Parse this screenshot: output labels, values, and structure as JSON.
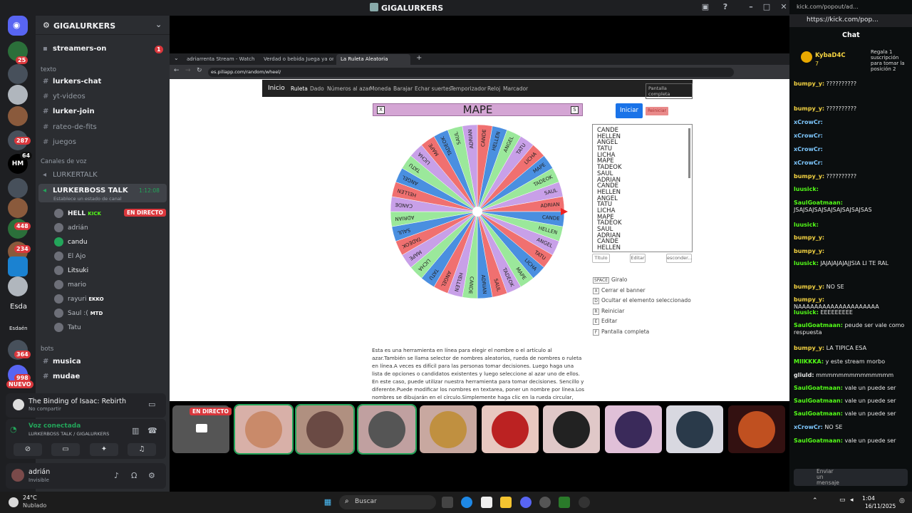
{
  "titlebar": {
    "title": "GIGALURKERS"
  },
  "server_rail": {
    "badges": [
      "25",
      "287",
      "448",
      "234",
      "364",
      "998",
      "NUEVO"
    ],
    "hm_label": "HM",
    "hm_badge": "64",
    "text_labels": [
      "Esda",
      "Esdaén"
    ]
  },
  "sidebar": {
    "server_name": "GIGALURKERS",
    "streamers_on": "streamers-on",
    "streamers_badge": "1",
    "cat_texto": "texto",
    "text_channels": [
      "lurkers-chat",
      "yt-videos",
      "lurker-join",
      "rateo-de-fits",
      "juegos"
    ],
    "cat_voz": "Canales de voz",
    "voice_lurkertalk": "LURKERTALK",
    "voice_boss": "LURKERBOSS TALK",
    "voice_timer": "1:12:08",
    "voice_status": "Establece un estado de canal",
    "users": [
      {
        "name": "HELL",
        "tag": "KICK",
        "live": "EN DIRECTO"
      },
      {
        "name": "adrián"
      },
      {
        "name": "candu"
      },
      {
        "name": "El Ajo"
      },
      {
        "name": "Litsuki"
      },
      {
        "name": "mario"
      },
      {
        "name": "rayuri",
        "tag": "EKKO"
      },
      {
        "name": "Saul :(",
        "tag": "MTD"
      },
      {
        "name": "Tatu"
      }
    ],
    "cat_bots": "bots",
    "bot_channels": [
      "musica",
      "mudae"
    ]
  },
  "activity": {
    "game": "The Binding of Isaac: Rebirth",
    "sub": "No compartir"
  },
  "voice_panel": {
    "title": "Voz conectada",
    "sub": "LURKERBOSS TALK / GIGALURKERS"
  },
  "user_panel": {
    "name": "adrián",
    "status": "Invisible"
  },
  "browser": {
    "tabs": [
      "adriarrenta Stream - Watch Liv...",
      "Verdad o bebida Juega ya onlin...",
      "La Ruleta Aleatoria"
    ],
    "url": "es.piliapp.com/random/wheel/"
  },
  "page": {
    "nav": [
      "Inicio",
      "Ruleta",
      "Dado",
      "Números al azar",
      "Moneda",
      "Barajar",
      "Echar suertes",
      "Temporizador",
      "Reloj",
      "Marcador",
      "Pantalla completa"
    ],
    "wheel_title": "MAPE",
    "close_x": "X",
    "s_label": "S",
    "start_btn": "Iniciar",
    "reset_btn": "Reiniciar",
    "names": [
      "CANDE",
      "HELLEN",
      "ANGEL",
      "TATU",
      "LICHA",
      "MAPE",
      "TADEOK",
      "SAUL",
      "ADRIAN",
      "CANDE",
      "HELLEN",
      "ANGEL",
      "TATU",
      "LICHA",
      "MAPE",
      "TADEOK",
      "SAUL",
      "ADRIAN",
      "CANDE",
      "HELLEN"
    ],
    "wheel_names": [
      "CANDE",
      "HELLEN",
      "ANGEL",
      "TATU",
      "LICHA",
      "MAPE",
      "TADEOK",
      "SAUL",
      "ADRIAN"
    ],
    "small_btns": [
      "Título",
      "Editar",
      "esconder..."
    ],
    "shortcuts": [
      {
        "key": "SPACE",
        "label": "Giralo"
      },
      {
        "key": "X",
        "label": "Cerrar el banner"
      },
      {
        "key": "D",
        "label": "Ocultar el elemento seleccionado"
      },
      {
        "key": "R",
        "label": "Reiniciar"
      },
      {
        "key": "E",
        "label": "Editar"
      },
      {
        "key": "F",
        "label": "Pantalla completa"
      }
    ],
    "description": "Esta es una herramienta en línea para elegir el nombre o el artículo al azar.También se llama selector de nombres aleatorios, rueda de nombres o ruleta en línea.A veces es difícil para las personas tomar decisiones. Luego haga una lista de opciones o candidatos existentes y luego seleccione al azar uno de ellos. En este caso, puede utilizar nuestra herramienta para tomar decisiones. Sencillo y diferente.Puede modificar los nombres en textarea, poner un nombre por línea.Los nombres se dibujarán en el círculo.Simplemente haga clic en la rueda circular, comenzará a girar durante unos segundos. El resultado es seleccionar al azar un"
  },
  "tiles": {
    "live": "EN DIRECTO"
  },
  "kick": {
    "url": "kick.com/popout/ad...",
    "addr": "https://kick.com/pop...",
    "title": "Chat",
    "pin_user": "KybaD4C",
    "pin_num": "7",
    "pin_text": "Regala 1 suscripción para tomar la posición 2",
    "messages": [
      {
        "u": "bumpy_y:",
        "c": "yl",
        "t": "??????????"
      },
      {
        "u": "bumpy_y:",
        "c": "yl",
        "t": "??????????"
      },
      {
        "u": "xCrowCr:",
        "c": "bl",
        "t": ""
      },
      {
        "u": "xCrowCr:",
        "c": "bl",
        "t": ""
      },
      {
        "u": "xCrowCr:",
        "c": "bl",
        "t": ""
      },
      {
        "u": "xCrowCr:",
        "c": "bl",
        "t": ""
      },
      {
        "u": "bumpy_y:",
        "c": "yl",
        "t": "??????????"
      },
      {
        "u": "luusick:",
        "c": "gr",
        "t": ""
      },
      {
        "u": "SaulGoatmaan:",
        "c": "gr",
        "t": "JSAJSAJSAJSAJSAJSAJSAJSAS"
      },
      {
        "u": "luusick:",
        "c": "gr",
        "t": ""
      },
      {
        "u": "bumpy_y:",
        "c": "yl",
        "t": ""
      },
      {
        "u": "bumpy_y:",
        "c": "yl",
        "t": ""
      },
      {
        "u": "luusick:",
        "c": "gr",
        "t": "JAJAJAJAJAJJSIA LI TE RAL"
      },
      {
        "u": "bumpy_y:",
        "c": "yl",
        "t": "NO SE"
      },
      {
        "u": "bumpy_y:",
        "c": "yl",
        "t": "NAAAAAAAAAAAAAAAAAAAA"
      },
      {
        "u": "luusick:",
        "c": "gr",
        "t": "EEEEEEEEE"
      },
      {
        "u": "SaulGoatmaan:",
        "c": "gr",
        "t": "peude ser vale como respuesta"
      },
      {
        "u": "bumpy_y:",
        "c": "yl",
        "t": "LA TIPICA ESA"
      },
      {
        "u": "MIIKKKA:",
        "c": "gr",
        "t": "y este stream morbo"
      },
      {
        "u": "gliuld:",
        "c": "wh",
        "t": "mmmmmmmmmmmmmm"
      },
      {
        "u": "SaulGoatmaan:",
        "c": "gr",
        "t": "vale un puede ser"
      },
      {
        "u": "SaulGoatmaan:",
        "c": "gr",
        "t": "vale un puede ser"
      },
      {
        "u": "SaulGoatmaan:",
        "c": "gr",
        "t": "vale un puede ser"
      },
      {
        "u": "xCrowCr:",
        "c": "bl",
        "t": "NO SE"
      },
      {
        "u": "SaulGoatmaan:",
        "c": "gr",
        "t": "vale un puede ser"
      }
    ],
    "send": "Enviar un mensaje"
  },
  "taskbar": {
    "temp": "24°C",
    "weather": "Nublado",
    "search": "Buscar",
    "time": "1:04",
    "date": "16/11/2025"
  }
}
